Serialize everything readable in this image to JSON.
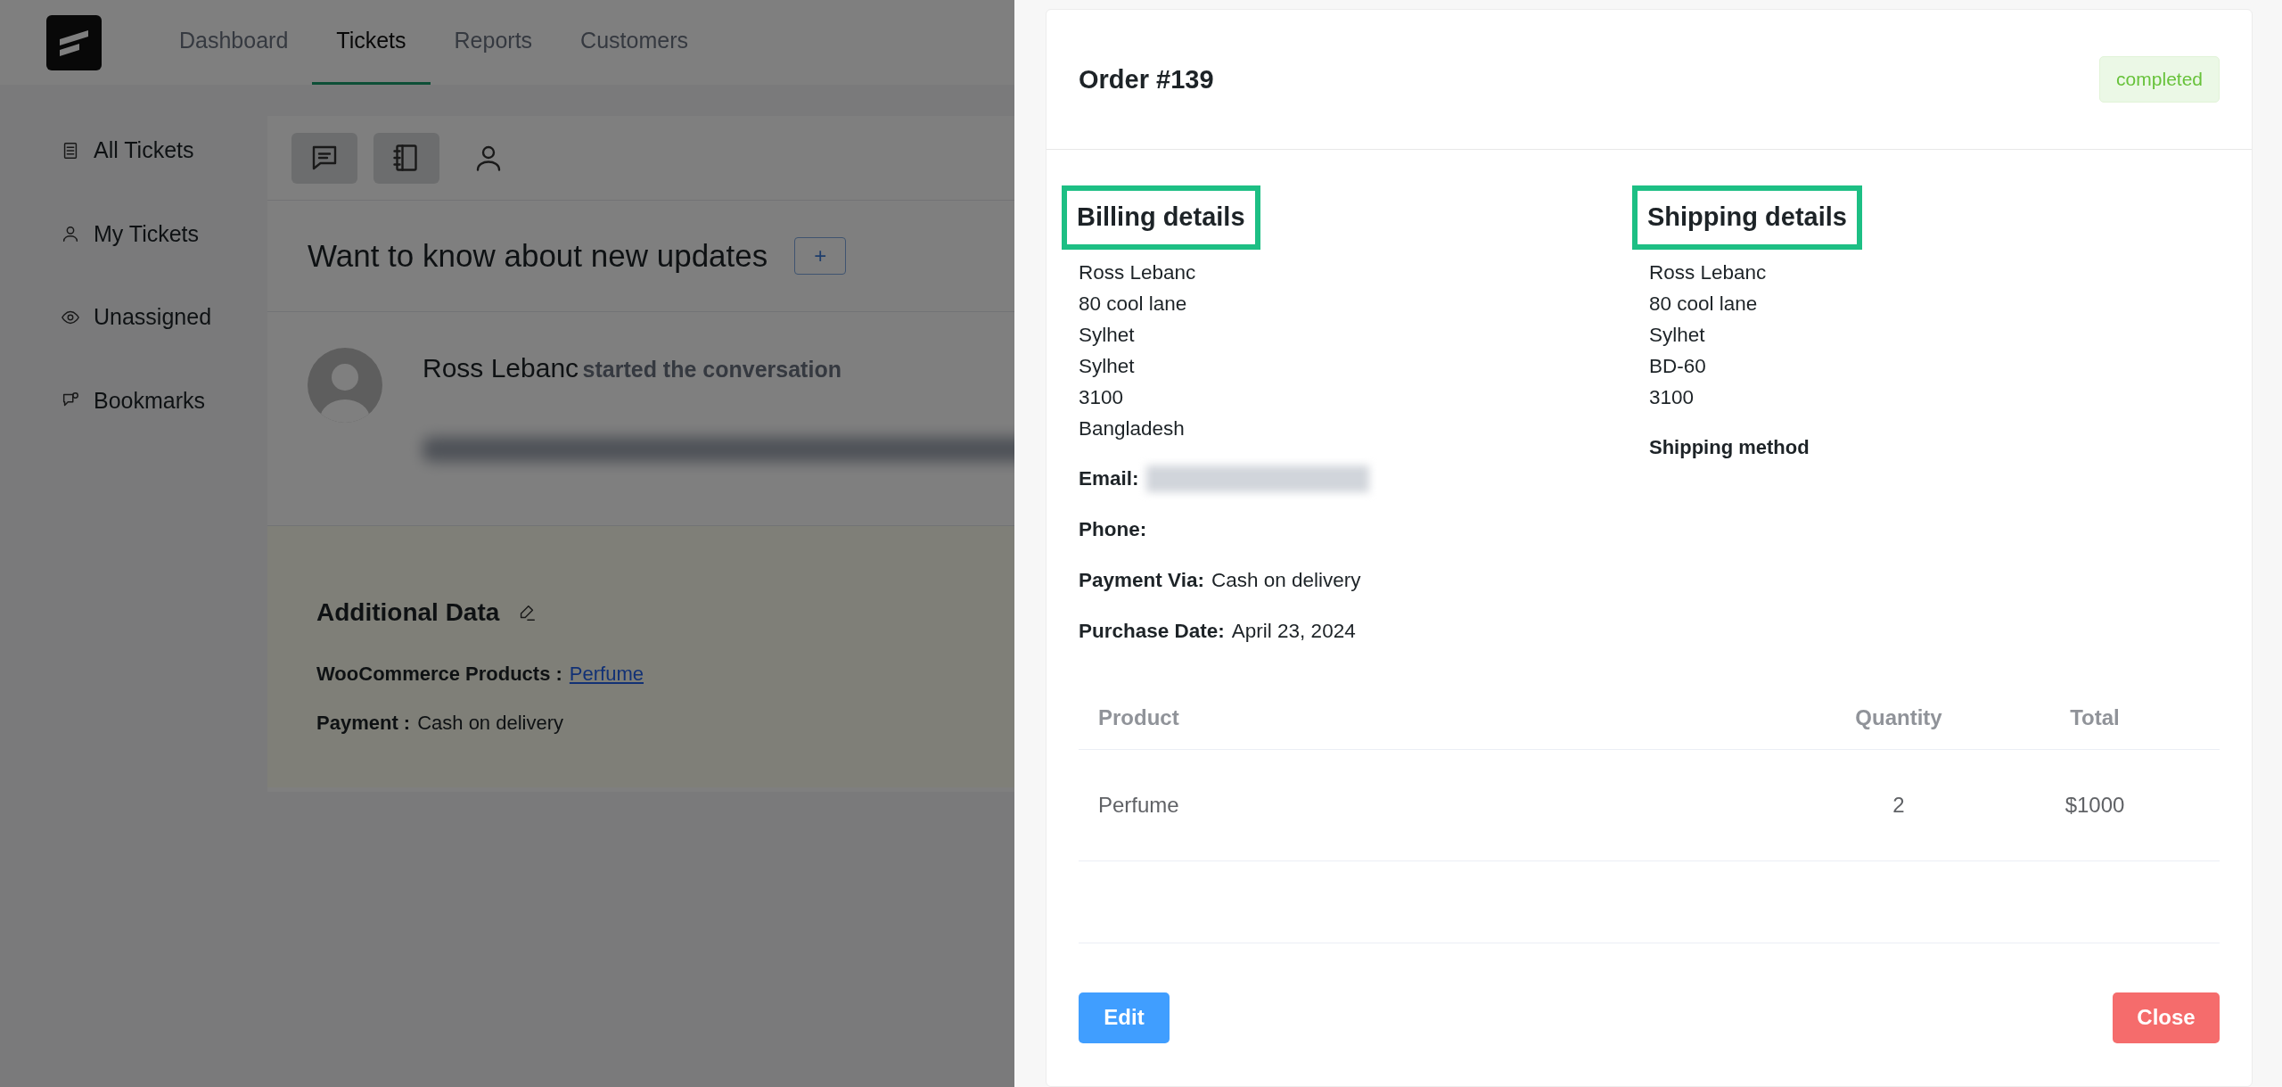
{
  "nav": {
    "tabs": [
      {
        "label": "Dashboard",
        "selected": false
      },
      {
        "label": "Tickets",
        "selected": true
      },
      {
        "label": "Reports",
        "selected": false
      },
      {
        "label": "Customers",
        "selected": false
      }
    ]
  },
  "sidebar": {
    "items": [
      {
        "label": "All Tickets"
      },
      {
        "label": "My Tickets"
      },
      {
        "label": "Unassigned"
      },
      {
        "label": "Bookmarks"
      }
    ]
  },
  "toolbar": {
    "buttons": [
      {
        "active": true
      },
      {
        "active": true
      },
      {
        "active": false
      }
    ]
  },
  "ticket": {
    "title": "Want to know about new updates",
    "add_button": "+",
    "author": "Ross Lebanc",
    "action": "started the conversation",
    "message_redacted": true
  },
  "additional_data": {
    "title": "Additional Data",
    "fields": [
      {
        "label": "WooCommerce Products :",
        "value": "Perfume",
        "kind": "link"
      },
      {
        "label": "Payment :",
        "value": "Cash on delivery",
        "kind": "text"
      }
    ]
  },
  "order": {
    "title": "Order #139",
    "status": "completed",
    "billing": {
      "heading": "Billing details",
      "highlighted": true,
      "lines": [
        "Ross Lebanc",
        "80 cool lane",
        "Sylhet",
        "Sylhet",
        "3100",
        "Bangladesh"
      ]
    },
    "shipping": {
      "heading": "Shipping details",
      "highlighted": true,
      "lines": [
        "Ross Lebanc",
        "80 cool lane",
        "Sylhet",
        "BD-60",
        "3100"
      ],
      "method_label": "Shipping method"
    },
    "info": [
      {
        "label": "Email:",
        "redacted": true
      },
      {
        "label": "Phone:",
        "redacted": false
      },
      {
        "label": "Payment Via:",
        "value": "Cash on delivery",
        "redacted": false
      },
      {
        "label": "Purchase Date:",
        "value": "April 23, 2024",
        "redacted": false
      }
    ],
    "table": {
      "columns": [
        "Product",
        "Quantity",
        "Total"
      ],
      "rows": [
        [
          "Perfume",
          "2",
          "$1000"
        ]
      ]
    },
    "edit_button": "Edit",
    "close_button": "Close"
  }
}
